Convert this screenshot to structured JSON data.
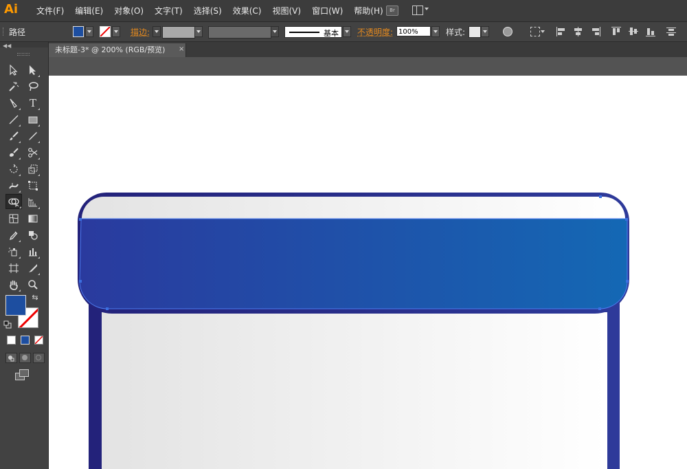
{
  "app": {
    "logo": "Ai",
    "menus": [
      "文件(F)",
      "编辑(E)",
      "对象(O)",
      "文字(T)",
      "选择(S)",
      "效果(C)",
      "视图(V)",
      "窗口(W)",
      "帮助(H)"
    ],
    "bridge_button": "Br"
  },
  "control_bar": {
    "object_type": "路径",
    "fill_color": "#1d4ea0",
    "stroke_label": "描边:",
    "stroke_profile": "基本",
    "opacity_label": "不透明度:",
    "opacity_value": "100%",
    "style_label": "样式:"
  },
  "document": {
    "tab_title": "未标题-3* @ 200% (RGB/预览)",
    "tab_close": "×"
  },
  "tools": {
    "fill_color": "#1d4ea0",
    "stroke_color": "none"
  },
  "artwork": {
    "outline_color": "#2b2f8a",
    "band_gradient": [
      "#2a3a9e",
      "#1468b4"
    ],
    "light_gradient": [
      "#e3e3e3",
      "#ffffff"
    ],
    "anchor_color": "#3b6fe0"
  }
}
